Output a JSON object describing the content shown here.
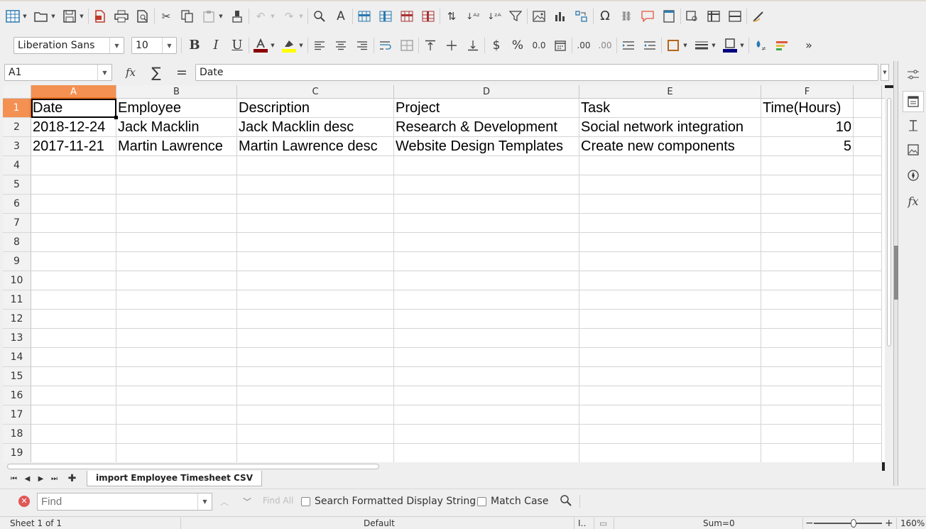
{
  "font_toolbar": {
    "font_name": "Liberation Sans",
    "font_size": "10",
    "bold_label": "B",
    "italic_label": "I",
    "underline_label": "U",
    "currency_label": "$",
    "percent_label": "%",
    "number_label": "0.0",
    "add_decimal_label": ".00",
    "del_decimal_label": ".00",
    "more_label": "»",
    "font_color": "#8b0000",
    "highlight_color": "#ffff00",
    "border_color": "#000080"
  },
  "formula_bar": {
    "name_box": "A1",
    "fx_label": "fx",
    "sum_label": "∑",
    "equals_label": "=",
    "content": "Date"
  },
  "grid": {
    "columns": [
      "A",
      "B",
      "C",
      "D",
      "E",
      "F"
    ],
    "rows": [
      "1",
      "2",
      "3",
      "4",
      "5",
      "6",
      "7",
      "8",
      "9",
      "10",
      "11",
      "12",
      "13",
      "14",
      "15",
      "16",
      "17",
      "18",
      "19"
    ],
    "header_row": [
      "Date",
      "Employee",
      "Description",
      "Project",
      "Task",
      "Time(Hours)"
    ],
    "data_rows": [
      [
        "2018-12-24",
        "Jack Macklin",
        "Jack Macklin desc",
        "Research & Development",
        "Social network integration",
        "10"
      ],
      [
        "2017-11-21",
        "Martin Lawrence",
        "Martin Lawrence desc",
        "Website Design Templates",
        "Create new components",
        "5"
      ]
    ],
    "selected_cell": "A1",
    "selection_color": "#f39052"
  },
  "sheet_tabs": {
    "active_tab": "import Employee Timesheet CSV"
  },
  "find_bar": {
    "placeholder": "Find",
    "find_all_label": "Find All",
    "formatted_label": "Search Formatted Display String",
    "match_case_label": "Match Case"
  },
  "status_bar": {
    "sheet_info": "Sheet 1 of 1",
    "page_style": "Default",
    "sum": "Sum=0",
    "zoom": "160%"
  }
}
